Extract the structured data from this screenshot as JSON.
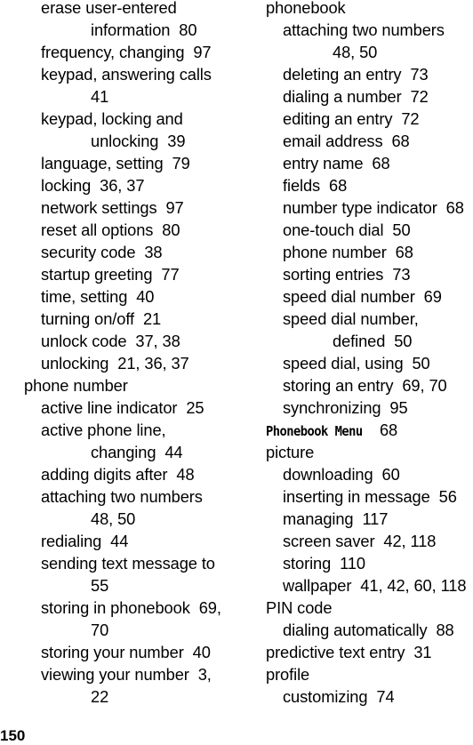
{
  "page_number": "150",
  "left_column": [
    {
      "level": 1,
      "text": "erase user-entered"
    },
    {
      "level": "cont",
      "text": "information  80"
    },
    {
      "level": 1,
      "text": "frequency, changing  97"
    },
    {
      "level": 1,
      "text": "keypad, answering calls"
    },
    {
      "level": "cont",
      "text": "41"
    },
    {
      "level": 1,
      "text": "keypad, locking and"
    },
    {
      "level": "cont",
      "text": "unlocking  39"
    },
    {
      "level": 1,
      "text": "language, setting  79"
    },
    {
      "level": 1,
      "text": "locking  36, 37"
    },
    {
      "level": 1,
      "text": "network settings  97"
    },
    {
      "level": 1,
      "text": "reset all options  80"
    },
    {
      "level": 1,
      "text": "security code  38"
    },
    {
      "level": 1,
      "text": "startup greeting  77"
    },
    {
      "level": 1,
      "text": "time, setting  40"
    },
    {
      "level": 1,
      "text": "turning on/off  21"
    },
    {
      "level": 1,
      "text": "unlock code  37, 38"
    },
    {
      "level": 1,
      "text": "unlocking  21, 36, 37"
    },
    {
      "level": 0,
      "text": "phone number"
    },
    {
      "level": 1,
      "text": "active line indicator  25"
    },
    {
      "level": 1,
      "text": "active phone line,"
    },
    {
      "level": "cont",
      "text": "changing  44"
    },
    {
      "level": 1,
      "text": "adding digits after  48"
    },
    {
      "level": 1,
      "text": "attaching two numbers"
    },
    {
      "level": "cont",
      "text": "48, 50"
    },
    {
      "level": 1,
      "text": "redialing  44"
    },
    {
      "level": 1,
      "text": "sending text message to"
    },
    {
      "level": "cont",
      "text": "55"
    },
    {
      "level": 1,
      "text": "storing in phonebook  69,"
    },
    {
      "level": "cont",
      "text": "70"
    },
    {
      "level": 1,
      "text": "storing your number  40"
    },
    {
      "level": 1,
      "text": "viewing your number  3,"
    },
    {
      "level": "cont",
      "text": "22"
    }
  ],
  "right_column": [
    {
      "level": 0,
      "text": "phonebook"
    },
    {
      "level": 1,
      "text": "attaching two numbers"
    },
    {
      "level": "cont",
      "text": "48, 50"
    },
    {
      "level": 1,
      "text": "deleting an entry  73"
    },
    {
      "level": 1,
      "text": "dialing a number  72"
    },
    {
      "level": 1,
      "text": "editing an entry  72"
    },
    {
      "level": 1,
      "text": "email address  68"
    },
    {
      "level": 1,
      "text": "entry name  68"
    },
    {
      "level": 1,
      "text": "fields  68"
    },
    {
      "level": 1,
      "text": "number type indicator  68"
    },
    {
      "level": 1,
      "text": "one-touch dial  50"
    },
    {
      "level": 1,
      "text": "phone number  68"
    },
    {
      "level": 1,
      "text": "sorting entries  73"
    },
    {
      "level": 1,
      "text": "speed dial number  69"
    },
    {
      "level": 1,
      "text": "speed dial number,"
    },
    {
      "level": "cont",
      "text": "defined  50"
    },
    {
      "level": 1,
      "text": "speed dial, using  50"
    },
    {
      "level": 1,
      "text": "storing an entry  69, 70"
    },
    {
      "level": 1,
      "text": "synchronizing  95"
    },
    {
      "level": 0,
      "text": "Phonebook Menu",
      "pages": "  68",
      "menu_term": true
    },
    {
      "level": 0,
      "text": "picture"
    },
    {
      "level": 1,
      "text": "downloading  60"
    },
    {
      "level": 1,
      "text": "inserting in message  56"
    },
    {
      "level": 1,
      "text": "managing  117"
    },
    {
      "level": 1,
      "text": "screen saver  42, 118"
    },
    {
      "level": 1,
      "text": "storing  110"
    },
    {
      "level": 1,
      "text": "wallpaper  41, 42, 60, 118"
    },
    {
      "level": 0,
      "text": "PIN code"
    },
    {
      "level": 1,
      "text": "dialing automatically  88"
    },
    {
      "level": 0,
      "text": "predictive text entry  31"
    },
    {
      "level": 0,
      "text": "profile"
    },
    {
      "level": 1,
      "text": "customizing  74"
    }
  ]
}
